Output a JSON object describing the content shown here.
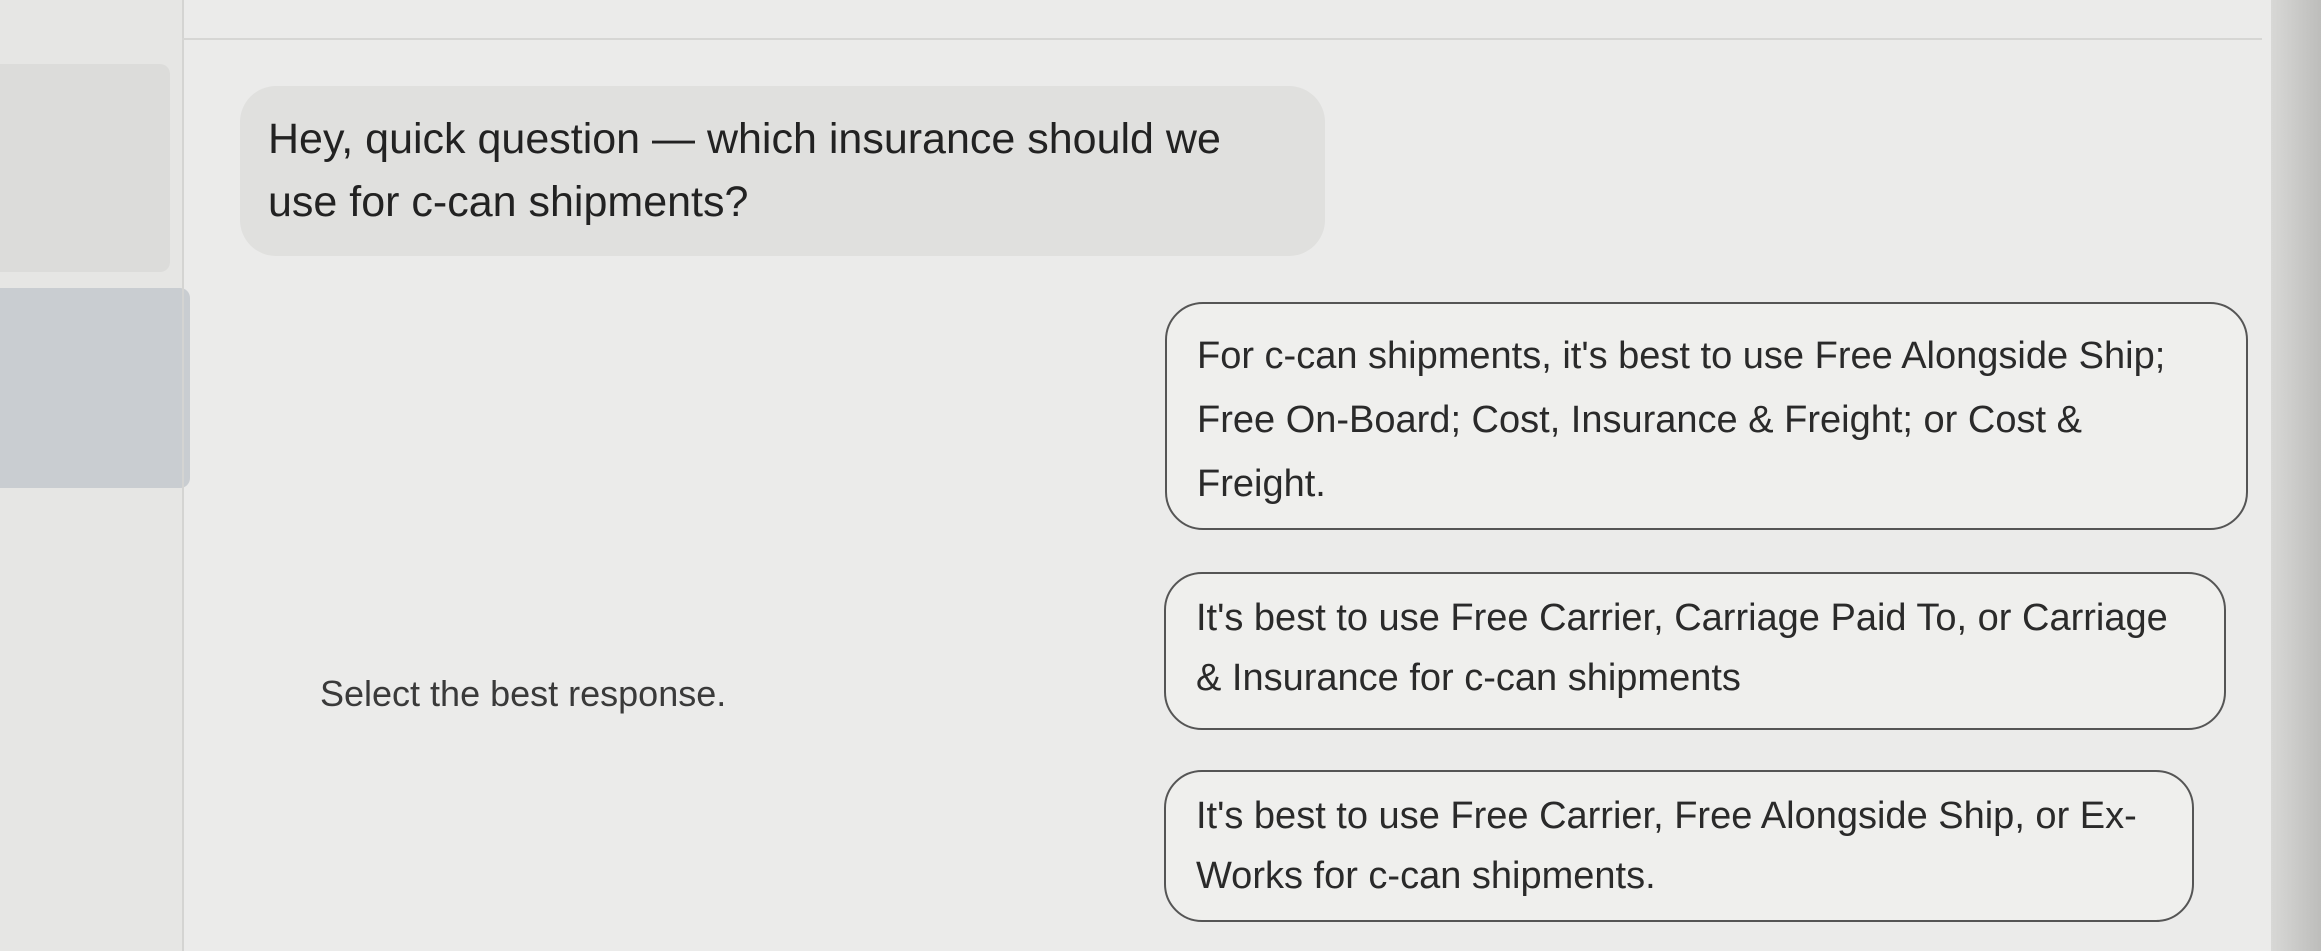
{
  "message": {
    "text": "Hey, quick question — which insurance should we use for c-can shipments?"
  },
  "instruction": "Select the best response.",
  "options": [
    {
      "label": "For c-can shipments, it's best to use Free Alongside Ship; Free On-Board; Cost, Insurance & Freight; or Cost & Freight."
    },
    {
      "label": "It's best to use Free Carrier, Carriage Paid To, or Carriage & Insurance for c-can shipments"
    },
    {
      "label": "It's best to use Free Carrier, Free Alongside Ship, or Ex-Works for c-can shipments."
    }
  ]
}
